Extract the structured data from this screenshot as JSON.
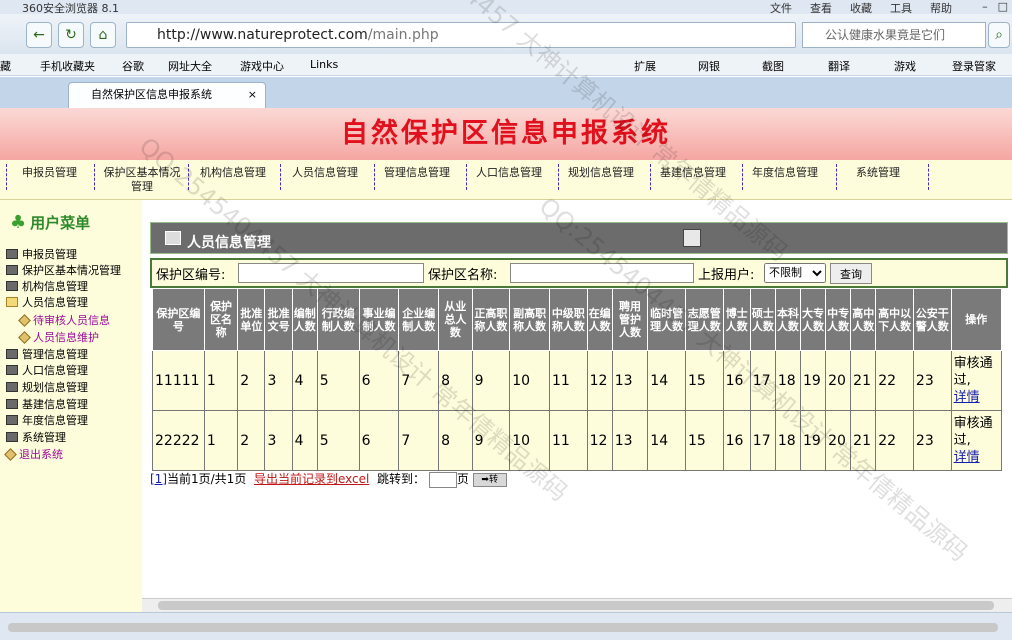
{
  "browser": {
    "app_title": "360安全浏览器 8.1",
    "menus": [
      "文件",
      "查看",
      "收藏",
      "工具",
      "帮助"
    ],
    "url_host": "http://www.natureprotect.com",
    "url_path": "/main.php",
    "search_placeholder": "公认健康水果竟是它们",
    "bookmarks": [
      "藏",
      "手机收藏夹",
      "谷歌",
      "网址大全",
      "游戏中心",
      "Links",
      "扩展",
      "网银",
      "截图",
      "翻译",
      "游戏",
      "登录管家"
    ],
    "tab_title": "自然保护区信息申报系统"
  },
  "banner": {
    "title": "自然保护区信息申报系统"
  },
  "main_menu": [
    "申报员管理",
    "保护区基本情况管理",
    "机构信息管理",
    "人员信息管理",
    "管理信息管理",
    "人口信息管理",
    "规划信息管理",
    "基建信息管理",
    "年度信息管理",
    "系统管理"
  ],
  "sidebar": {
    "title": "用户菜单",
    "items": [
      {
        "label": "申报员管理"
      },
      {
        "label": "保护区基本情况管理"
      },
      {
        "label": "机构信息管理"
      },
      {
        "label": "人员信息管理"
      },
      {
        "label": "待审核人员信息"
      },
      {
        "label": "人员信息维护"
      },
      {
        "label": "管理信息管理"
      },
      {
        "label": "人口信息管理"
      },
      {
        "label": "规划信息管理"
      },
      {
        "label": "基建信息管理"
      },
      {
        "label": "年度信息管理"
      },
      {
        "label": "系统管理"
      },
      {
        "label": "退出系统"
      }
    ]
  },
  "panel": {
    "title": "人员信息管理"
  },
  "filter": {
    "code_label": "保护区编号:",
    "name_label": "保护区名称:",
    "user_label": "上报用户:",
    "user_selected": "不限制",
    "query_button": "查询"
  },
  "table": {
    "headers": [
      "保护区编号",
      "保护区名称",
      "批准单位",
      "批准文号",
      "编制人数",
      "行政编制人数",
      "事业编制人数",
      "企业编制人数",
      "从业总人数",
      "正高职称人数",
      "副高职称人数",
      "中级职称人数",
      "在编人数",
      "聘用管护人数",
      "临时管理人数",
      "志愿管理人数",
      "博士人数",
      "硕士人数",
      "本科人数",
      "大专人数",
      "中专人数",
      "高中人数",
      "高中以下人数",
      "公安干警人数",
      "操作"
    ],
    "rows": [
      {
        "cells": [
          "11111",
          "1",
          "2",
          "3",
          "4",
          "5",
          "6",
          "7",
          "8",
          "9",
          "10",
          "11",
          "12",
          "13",
          "14",
          "15",
          "16",
          "17",
          "18",
          "19",
          "20",
          "21",
          "22",
          "23"
        ],
        "status": "审核通过,",
        "detail": "详情"
      },
      {
        "cells": [
          "22222",
          "1",
          "2",
          "3",
          "4",
          "5",
          "6",
          "7",
          "8",
          "9",
          "10",
          "11",
          "12",
          "13",
          "14",
          "15",
          "16",
          "17",
          "18",
          "19",
          "20",
          "21",
          "22",
          "23"
        ],
        "status": "审核通过,",
        "detail": "详情"
      }
    ]
  },
  "pager": {
    "page_link": "[1]",
    "page_info": "当前1页/共1页",
    "export": "导出当前记录到excel",
    "jump_label": "跳转到：",
    "page_unit": "页",
    "go": "➡转"
  },
  "watermark": {
    "text": "QQ:2545404457 大神计算机设计 常年倩精品源码"
  }
}
